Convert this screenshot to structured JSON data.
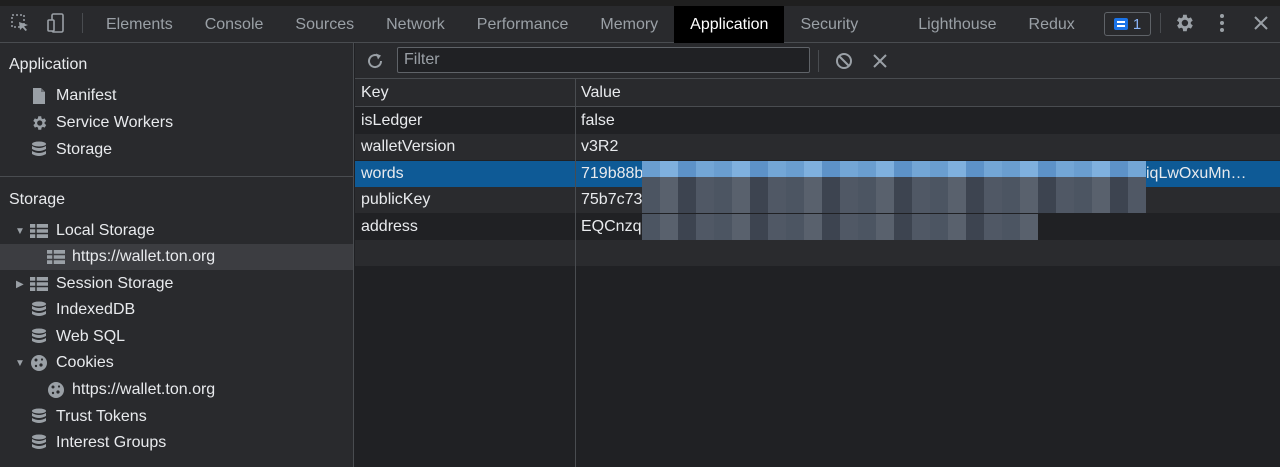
{
  "toolbar": {
    "tabs": [
      "Elements",
      "Console",
      "Sources",
      "Network",
      "Performance",
      "Memory",
      "Application",
      "Security",
      "Lighthouse",
      "Redux"
    ],
    "active_tab": "Application",
    "issues_count": "1"
  },
  "sidebar": {
    "application_title": "Application",
    "application_items": [
      "Manifest",
      "Service Workers",
      "Storage"
    ],
    "storage_title": "Storage",
    "storage_items": [
      "Local Storage",
      "https://wallet.ton.org",
      "Session Storage",
      "IndexedDB",
      "Web SQL",
      "Cookies",
      "https://wallet.ton.org",
      "Trust Tokens",
      "Interest Groups"
    ],
    "selected_item": "https://wallet.ton.org"
  },
  "filter": {
    "placeholder": "Filter"
  },
  "table": {
    "columns": [
      "Key",
      "Value"
    ],
    "rows": [
      {
        "key": "isLedger",
        "value": "false"
      },
      {
        "key": "walletVersion",
        "value": "v3R2"
      },
      {
        "key": "words",
        "value": "719b88b",
        "value_tail": "iqLwOxuMn…"
      },
      {
        "key": "publicKey",
        "value": "75b7c73"
      },
      {
        "key": "address",
        "value": "EQCnzqc"
      }
    ],
    "selected_row": "words"
  },
  "colors": {
    "accent": "#0e5a96",
    "background": "#202124",
    "panel": "#292a2d"
  }
}
